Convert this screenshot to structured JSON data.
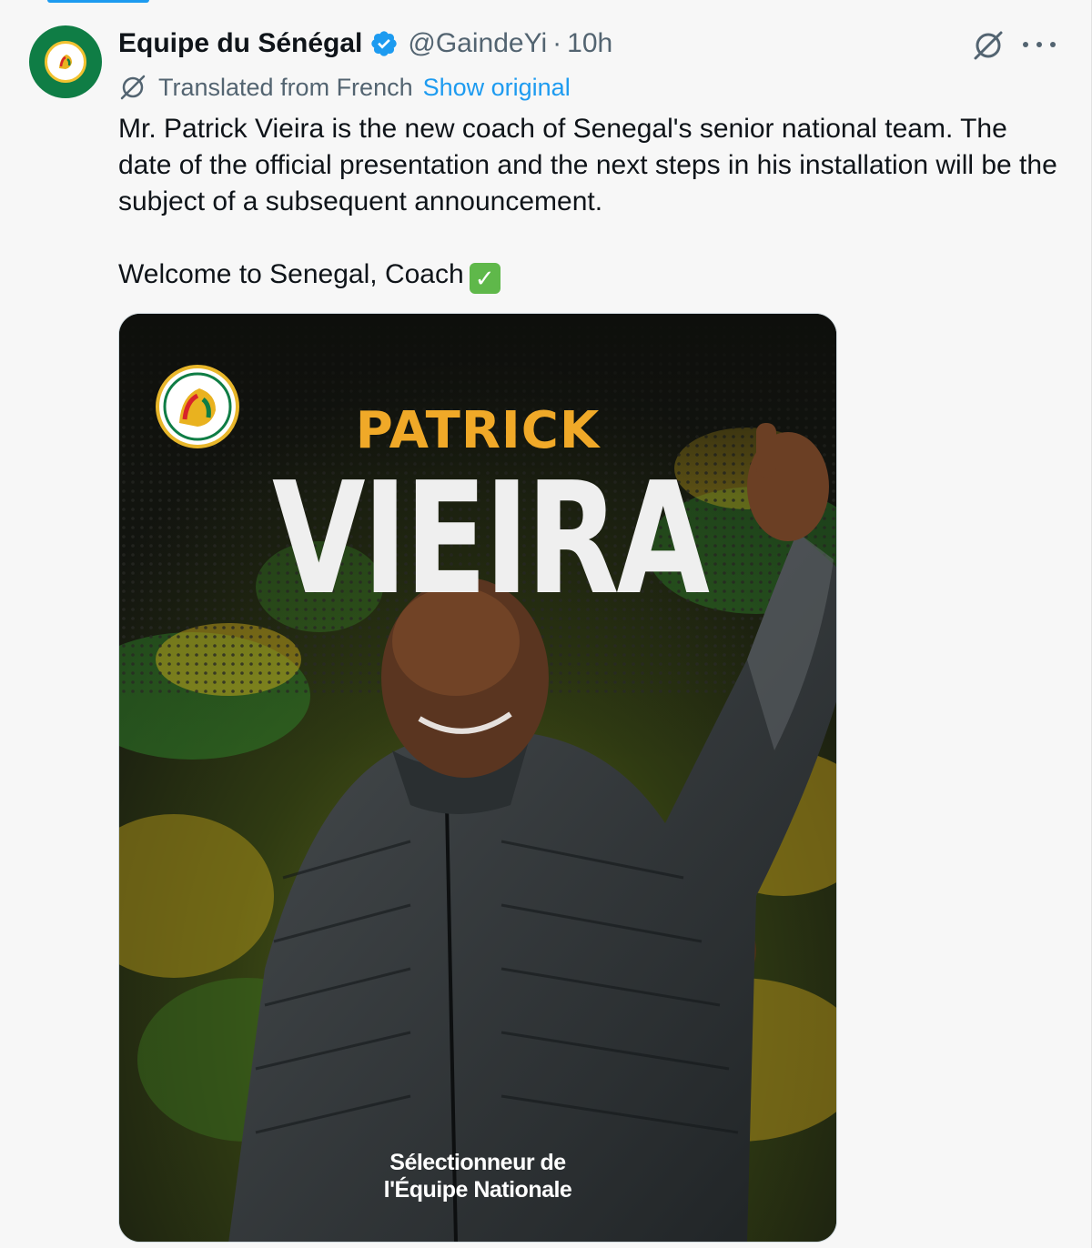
{
  "author": {
    "display_name": "Equipe du Sénégal",
    "handle": "@GaindeYi",
    "separator": "·",
    "time": "10h",
    "verified": true,
    "avatar_icon": "fsf-crest-avatar"
  },
  "translation": {
    "label": "Translated from French",
    "action": "Show original",
    "icon": "translate-icon"
  },
  "tweet": {
    "paragraph_1": "Mr. Patrick Vieira is the new coach of Senegal's senior national team. The date of the official presentation and the next steps in his installation will be the subject of a subsequent announcement.",
    "paragraph_2": "Welcome to Senegal, Coach",
    "emoji": "✓"
  },
  "media": {
    "first_name": "PATRICK",
    "last_name": "VIEIRA",
    "caption_line_1": "Sélectionneur de",
    "caption_line_2": "l'Équipe Nationale"
  },
  "colors": {
    "accent": "#1d9bf0",
    "poster_gold": "#f0a928",
    "senegal_green": "#0f7d45",
    "senegal_yellow": "#f2c230",
    "senegal_red": "#d8232a"
  }
}
